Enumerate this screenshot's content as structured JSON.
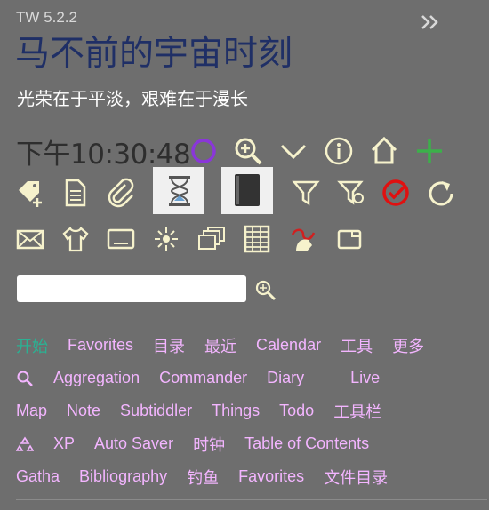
{
  "header": {
    "version": "TW 5.2.2"
  },
  "site": {
    "title": "马不前的宇宙时刻",
    "subtitle": "光荣在于平淡，艰难在于漫长"
  },
  "clock": {
    "text": "下午10:30:48"
  },
  "toolbar": {
    "row1": [
      "clock-circle-icon",
      "zoom-in-icon",
      "chevron-down-icon",
      "info-icon",
      "home-icon",
      "plus-icon"
    ],
    "row2": [
      "new-tag-icon",
      "new-page-icon",
      "paperclip-icon",
      "hourglass-icon",
      "book-icon",
      "funnel-icon",
      "funnel-search-icon",
      "check-badge-icon",
      "refresh-icon"
    ],
    "row3": [
      "envelope-icon",
      "t-shirt-icon",
      "monitor-icon",
      "sun-icon",
      "stack-icon",
      "spreadsheet-icon",
      "cat-paw-icon",
      "window-icon"
    ]
  },
  "search": {
    "value": "",
    "placeholder": ""
  },
  "tabs": {
    "row1": [
      "开始",
      "Favorites",
      "目录",
      "最近",
      "Calendar",
      "工具",
      "更多"
    ],
    "row2": [
      "Aggregation",
      "Commander",
      "Diary",
      "Live"
    ],
    "row3": [
      "Map",
      "Note",
      "Subtiddler",
      "Things",
      "Todo",
      "工具栏"
    ],
    "row4": [
      "XP",
      "Auto Saver",
      "时钟",
      "Table of Contents"
    ],
    "row5": [
      "Gatha",
      "Bibliography",
      "钓鱼",
      "Favorites",
      "文件目录"
    ]
  },
  "colors": {
    "accent": "#2bb193",
    "tab": "#f3b5ff",
    "icon": "#f6f2cc",
    "background": "#6e6e6e",
    "title": "#1f2f66"
  }
}
